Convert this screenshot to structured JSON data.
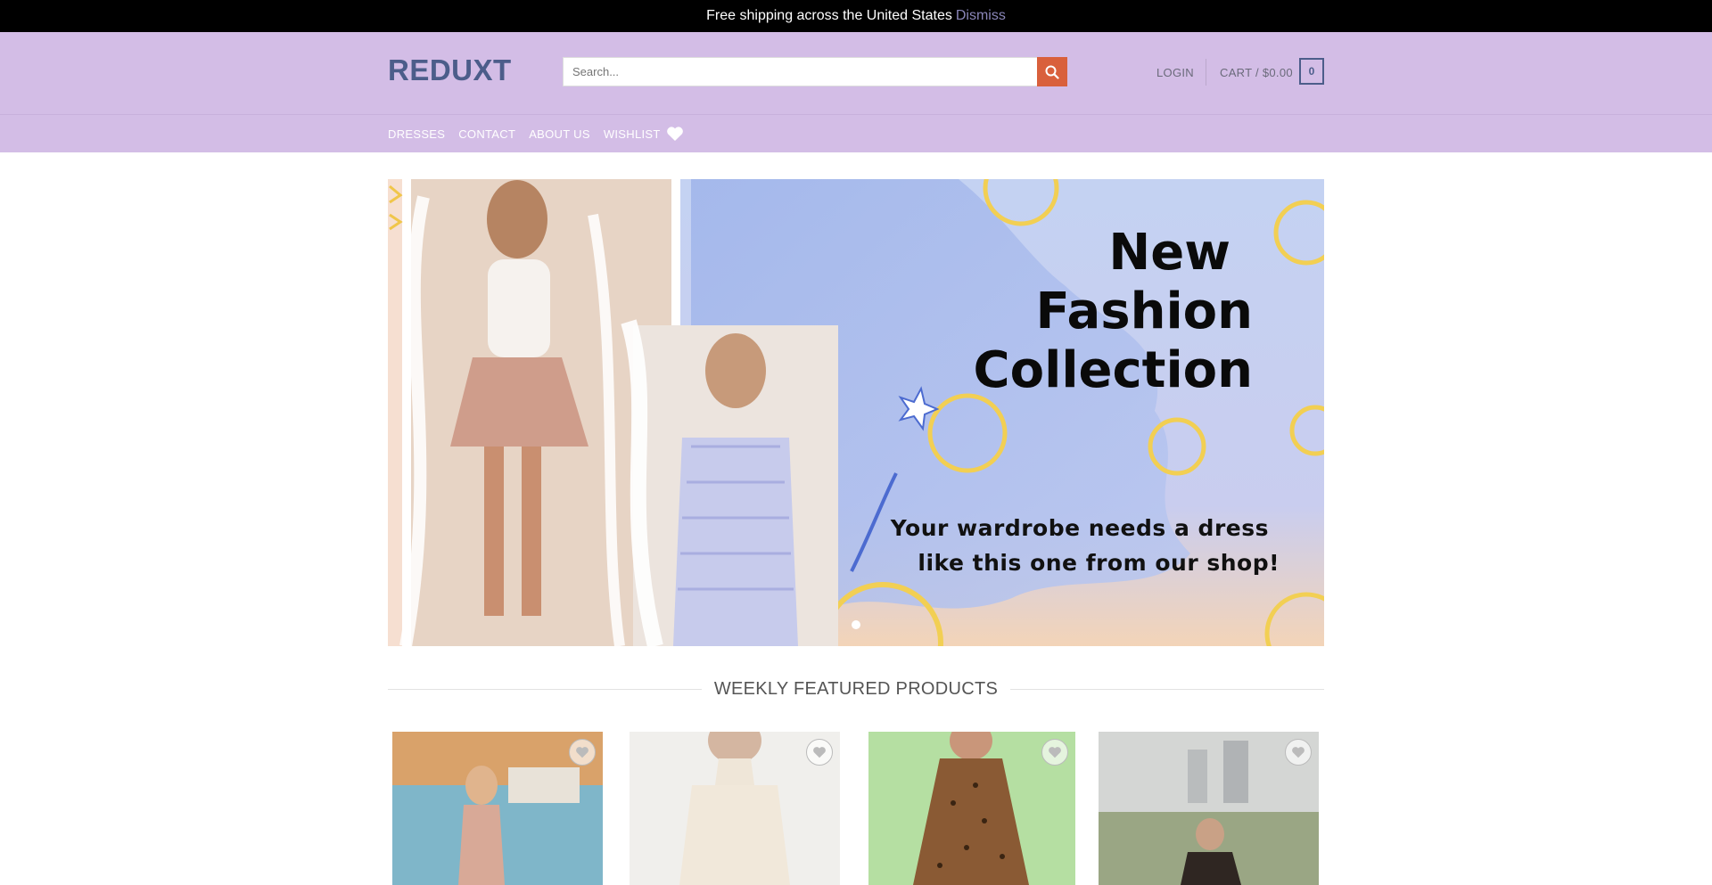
{
  "topbar": {
    "message": "Free shipping across the United States",
    "dismiss": "Dismiss"
  },
  "header": {
    "logo": "REDUXT",
    "search_placeholder": "Search...",
    "login": "LOGIN",
    "cart_label": "CART / $0.00",
    "cart_count": "0"
  },
  "nav": [
    {
      "label": "DRESSES"
    },
    {
      "label": "CONTACT"
    },
    {
      "label": "ABOUT US"
    },
    {
      "label": "WISHLIST"
    }
  ],
  "hero": {
    "title_lines": [
      "New",
      "Fashion",
      "Collection"
    ],
    "tagline_lines": [
      "Your wardrobe needs a dress",
      "like this one from our shop!"
    ]
  },
  "section": {
    "title": "WEEKLY FEATURED PRODUCTS"
  },
  "colors": {
    "header_bg": "#d3bde6",
    "accent": "#d9603c",
    "logo": "#4c5d8a"
  },
  "icons": {
    "search": "search-icon",
    "wishlist": "heart-icon",
    "product_wishlist": "heart-outline-icon"
  }
}
